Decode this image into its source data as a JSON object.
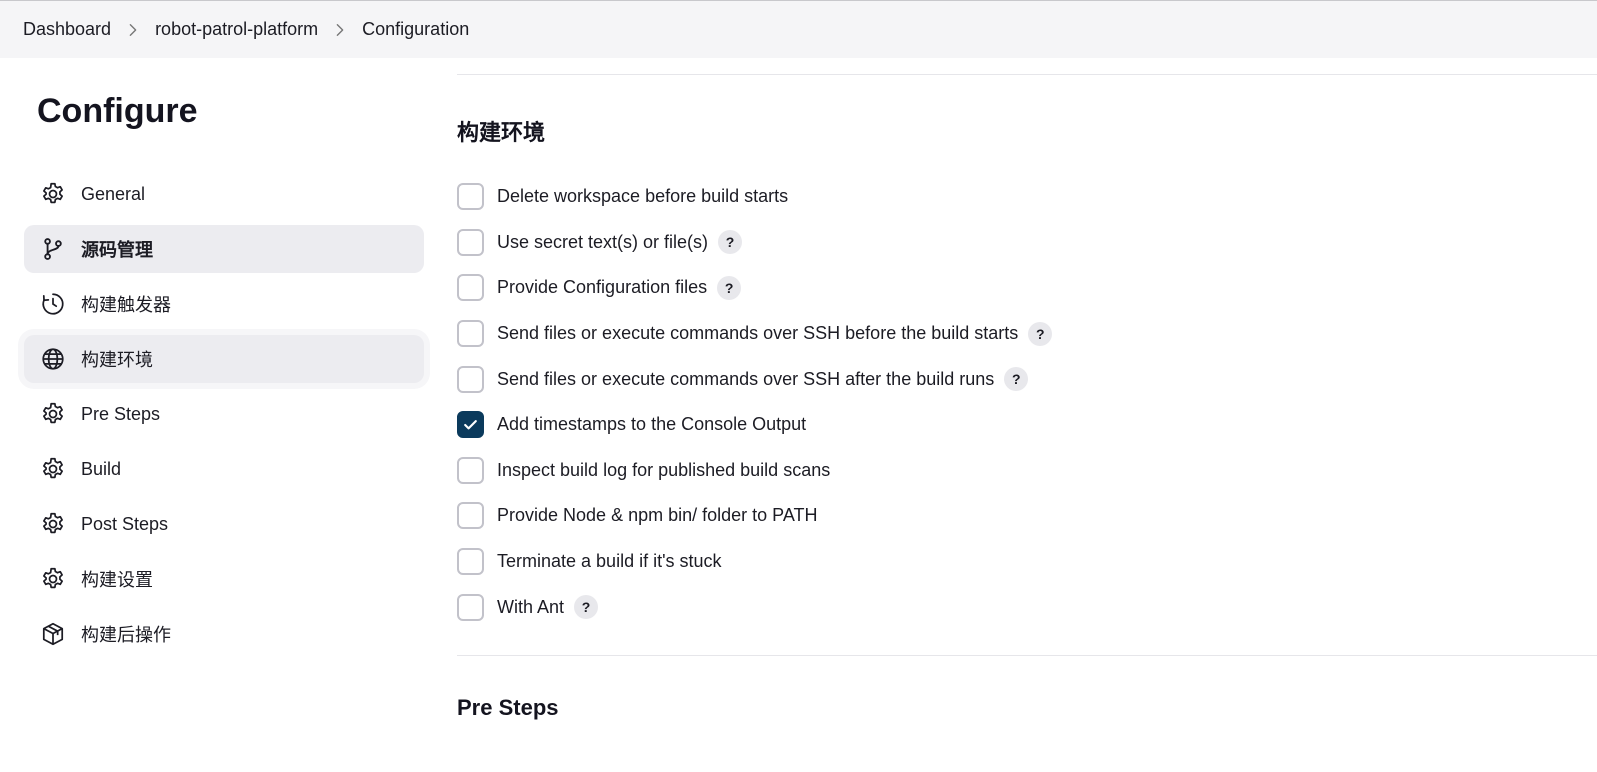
{
  "breadcrumb": {
    "items": [
      {
        "label": "Dashboard"
      },
      {
        "label": "robot-patrol-platform"
      },
      {
        "label": "Configuration"
      }
    ]
  },
  "sidebar": {
    "title": "Configure",
    "items": [
      {
        "label": "General",
        "icon": "gear-icon"
      },
      {
        "label": "源码管理",
        "icon": "git-branch-icon",
        "state": "active"
      },
      {
        "label": "构建触发器",
        "icon": "clock-icon"
      },
      {
        "label": "构建环境",
        "icon": "globe-icon",
        "state": "hover"
      },
      {
        "label": "Pre Steps",
        "icon": "gear-icon"
      },
      {
        "label": "Build",
        "icon": "gear-icon"
      },
      {
        "label": "Post Steps",
        "icon": "gear-icon"
      },
      {
        "label": "构建设置",
        "icon": "gear-icon"
      },
      {
        "label": "构建后操作",
        "icon": "package-icon"
      }
    ]
  },
  "main": {
    "section_title": "构建环境",
    "next_section_title": "Pre Steps",
    "help_label": "?",
    "options": [
      {
        "label": "Delete workspace before build starts",
        "checked": false,
        "help": false
      },
      {
        "label": "Use secret text(s) or file(s)",
        "checked": false,
        "help": true
      },
      {
        "label": "Provide Configuration files",
        "checked": false,
        "help": true
      },
      {
        "label": "Send files or execute commands over SSH before the build starts",
        "checked": false,
        "help": true
      },
      {
        "label": "Send files or execute commands over SSH after the build runs",
        "checked": false,
        "help": true
      },
      {
        "label": "Add timestamps to the Console Output",
        "checked": true,
        "help": false
      },
      {
        "label": "Inspect build log for published build scans",
        "checked": false,
        "help": false
      },
      {
        "label": "Provide Node & npm bin/ folder to PATH",
        "checked": false,
        "help": false
      },
      {
        "label": "Terminate a build if it's stuck",
        "checked": false,
        "help": false
      },
      {
        "label": "With Ant",
        "checked": false,
        "help": true
      }
    ]
  },
  "colors": {
    "accent_checkbox": "#0b3a5c",
    "sidebar_active_bg": "#ececf0",
    "breadcrumb_bg": "#f5f5f7"
  }
}
